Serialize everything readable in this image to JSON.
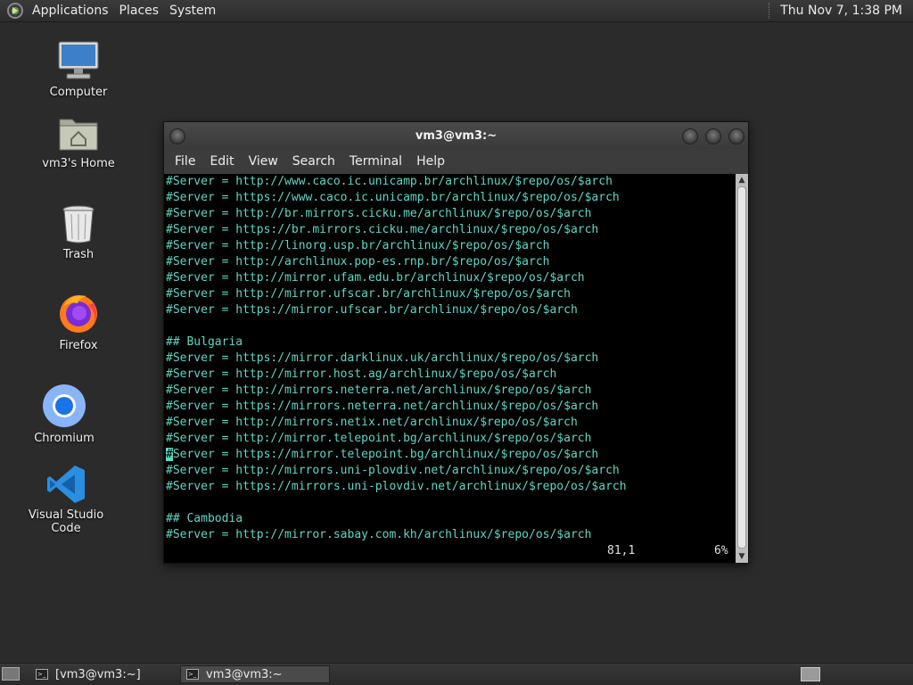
{
  "top_panel": {
    "menus": [
      "Applications",
      "Places",
      "System"
    ],
    "clock": "Thu Nov  7,  1:38 PM"
  },
  "desktop_icons": [
    {
      "label": "Computer",
      "icon": "computer-icon"
    },
    {
      "label": "vm3's Home",
      "icon": "home-folder-icon"
    },
    {
      "label": "Trash",
      "icon": "trash-icon"
    },
    {
      "label": "Firefox",
      "icon": "firefox-icon"
    },
    {
      "label": "Chromium",
      "icon": "chromium-icon"
    },
    {
      "label": "Visual Studio Code",
      "icon": "vscode-icon"
    }
  ],
  "terminal": {
    "title": "vm3@vm3:~",
    "menu": [
      "File",
      "Edit",
      "View",
      "Search",
      "Terminal",
      "Help"
    ],
    "lines": [
      "#Server = http://www.caco.ic.unicamp.br/archlinux/$repo/os/$arch",
      "#Server = https://www.caco.ic.unicamp.br/archlinux/$repo/os/$arch",
      "#Server = http://br.mirrors.cicku.me/archlinux/$repo/os/$arch",
      "#Server = https://br.mirrors.cicku.me/archlinux/$repo/os/$arch",
      "#Server = http://linorg.usp.br/archlinux/$repo/os/$arch",
      "#Server = http://archlinux.pop-es.rnp.br/$repo/os/$arch",
      "#Server = http://mirror.ufam.edu.br/archlinux/$repo/os/$arch",
      "#Server = http://mirror.ufscar.br/archlinux/$repo/os/$arch",
      "#Server = https://mirror.ufscar.br/archlinux/$repo/os/$arch",
      "",
      "## Bulgaria",
      "#Server = https://mirror.darklinux.uk/archlinux/$repo/os/$arch",
      "#Server = http://mirror.host.ag/archlinux/$repo/os/$arch",
      "#Server = http://mirrors.neterra.net/archlinux/$repo/os/$arch",
      "#Server = https://mirrors.neterra.net/archlinux/$repo/os/$arch",
      "#Server = http://mirrors.netix.net/archlinux/$repo/os/$arch",
      "#Server = http://mirror.telepoint.bg/archlinux/$repo/os/$arch",
      "#Server = https://mirror.telepoint.bg/archlinux/$repo/os/$arch",
      "#Server = http://mirrors.uni-plovdiv.net/archlinux/$repo/os/$arch",
      "#Server = https://mirrors.uni-plovdiv.net/archlinux/$repo/os/$arch",
      "",
      "## Cambodia",
      "#Server = http://mirror.sabay.com.kh/archlinux/$repo/os/$arch"
    ],
    "cursor_line": 17,
    "status_position": "81,1",
    "status_percent": "6%"
  },
  "taskbar": {
    "tasks": [
      {
        "label": "[vm3@vm3:~]",
        "active": false
      },
      {
        "label": "vm3@vm3:~",
        "active": true
      }
    ]
  }
}
